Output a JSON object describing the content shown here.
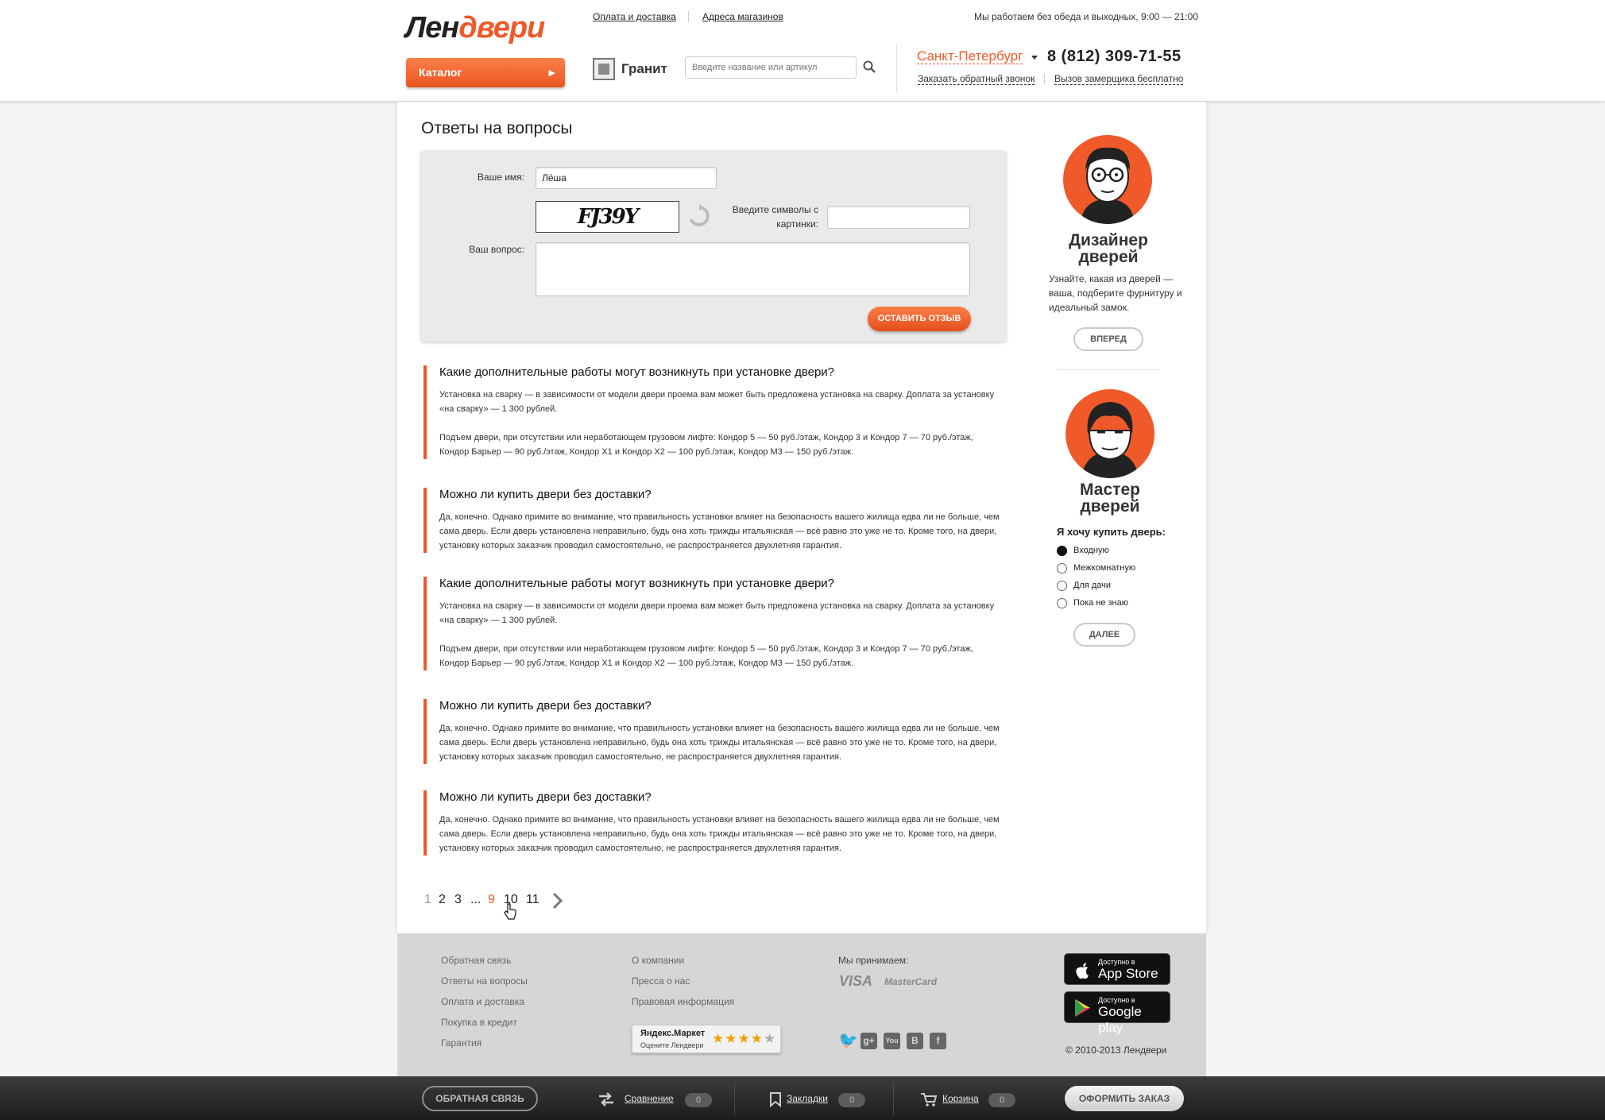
{
  "header": {
    "logo_part1": "Лен",
    "logo_part2": "двери",
    "catalog_label": "Каталог",
    "top_links": [
      "Оплата и доставка",
      "Адреса магазинов"
    ],
    "work_hours": "Мы работаем без обеда и выходных, 9:00 — 21:00",
    "brand": "Гранит",
    "search_placeholder": "Введите название или артикул",
    "city": "Санкт-Петербург",
    "phone": "8 (812) 309-71-55",
    "callback_link": "Заказать обратный звонок",
    "measurer_link": "Вызов замерщика бесплатно"
  },
  "page": {
    "title": "Ответы на вопросы"
  },
  "form": {
    "name_label": "Ваше имя:",
    "name_value": "Лёша",
    "captcha_label": "Введите символы с картинки:",
    "captcha_text": "FJ39Y",
    "captcha_value": "",
    "question_label": "Ваш вопрос:",
    "question_value": "",
    "submit_label": "ОСТАВИТЬ ОТЗЫВ"
  },
  "faq": [
    {
      "question": "Какие дополнительные работы могут возникнуть при установке двери?",
      "paragraphs": [
        "Установка на сварку — в зависимости от модели двери проема вам может быть предложена установка на сварку. Доплата за установку «на сварку» — 1 300 рублей.",
        "Подъем двери, при отсутствии или неработающем грузовом лифте: Кондор 5 — 50 руб./этаж, Кондор 3 и Кондор 7 — 70 руб./этаж, Кондор Барьер — 90 руб./этаж, Кондор Х1 и Кондор Х2 — 100 руб./этаж, Кондор М3 — 150 руб./этаж."
      ]
    },
    {
      "question": "Можно ли купить двери без доставки?",
      "paragraphs": [
        "Да, конечно. Однако примите во внимание, что правильность установки влияет на безопасность вашего жилища едва ли не больше, чем сама дверь. Если дверь установлена неправильно, будь она хоть трижды итальянская — всё равно это уже не то. Кроме того, на двери, установку которых заказчик проводил самостоятельно, не распространяется двухлетняя гарантия."
      ]
    },
    {
      "question": "Какие дополнительные работы могут возникнуть при установке двери?",
      "paragraphs": [
        "Установка на сварку — в зависимости от модели двери проема вам может быть предложена установка на сварку. Доплата за установку «на сварку» — 1 300 рублей.",
        "Подъем двери, при отсутствии или неработающем грузовом лифте: Кондор 5 — 50 руб./этаж, Кондор 3 и Кондор 7 — 70 руб./этаж, Кондор Барьер — 90 руб./этаж, Кондор Х1 и Кондор Х2 — 100 руб./этаж, Кондор М3 — 150 руб./этаж."
      ]
    },
    {
      "question": "Можно ли купить двери без доставки?",
      "paragraphs": [
        "Да, конечно. Однако примите во внимание, что правильность установки влияет на безопасность вашего жилища едва ли не больше, чем сама дверь. Если дверь установлена неправильно, будь она хоть трижды итальянская — всё равно это уже не то. Кроме того, на двери, установку которых заказчик проводил самостоятельно, не распространяется двухлетняя гарантия."
      ]
    },
    {
      "question": "Можно ли купить двери без доставки?",
      "paragraphs": [
        "Да, конечно. Однако примите во внимание, что правильность установки влияет на безопасность вашего жилища едва ли не больше, чем сама дверь. Если дверь установлена неправильно, будь она хоть трижды итальянская — всё равно это уже не то. Кроме того, на двери, установку которых заказчик проводил самостоятельно, не распространяется двухлетняя гарантия."
      ]
    }
  ],
  "pagination": {
    "items": [
      "1",
      "2",
      "3",
      "...",
      "9",
      "10",
      "11"
    ],
    "active": "9"
  },
  "sidebar": {
    "designer_title": "Дизайнер дверей",
    "designer_text": "Узнайте, какая из дверей — ваша, подберите фурнитуру и идеальный замок.",
    "designer_button": "ВПЕРЕД",
    "master_title": "Мастер дверей",
    "want_title": "Я хочу купить дверь:",
    "options": [
      "Входную",
      "Межкомнатную",
      "Для дачи",
      "Пока не знаю"
    ],
    "selected_option": "Входную",
    "master_button": "ДАЛЕЕ"
  },
  "footer": {
    "col1": [
      "Обратная связь",
      "Ответы на вопросы",
      "Оплата и доставка",
      "Покупка в кредит",
      "Гарантия"
    ],
    "col2": [
      "О компании",
      "Пресса о нас",
      "Правовая информация"
    ],
    "accept_label": "Мы принимаем:",
    "cards": [
      "VISA",
      "MasterCard"
    ],
    "ym_title": "Яндекс.Маркет",
    "ym_sub": "Оцените Лендвери",
    "ym_rating": 4,
    "social": [
      "twitter-icon",
      "google-plus-icon",
      "youtube-icon",
      "vk-icon",
      "facebook-icon"
    ],
    "appstore_small": "Доступно в",
    "appstore_big": "App Store",
    "gplay_small": "Доступно в",
    "gplay_big": "Google play",
    "copyright": "© 2010-2013 Лендвери"
  },
  "bottom_bar": {
    "feedback_label": "ОБРАТНАЯ СВЯЗЬ",
    "compare_label": "Сравнение",
    "compare_count": "0",
    "bookmarks_label": "Закладки",
    "bookmarks_count": "0",
    "cart_label": "Корзина",
    "cart_count": "0",
    "order_label": "ОФОРМИТЬ ЗАКАЗ"
  },
  "colors": {
    "accent": "#f0592a",
    "footer_bg": "#d6d6d6",
    "bottom_bar": "#2a2a2a"
  }
}
